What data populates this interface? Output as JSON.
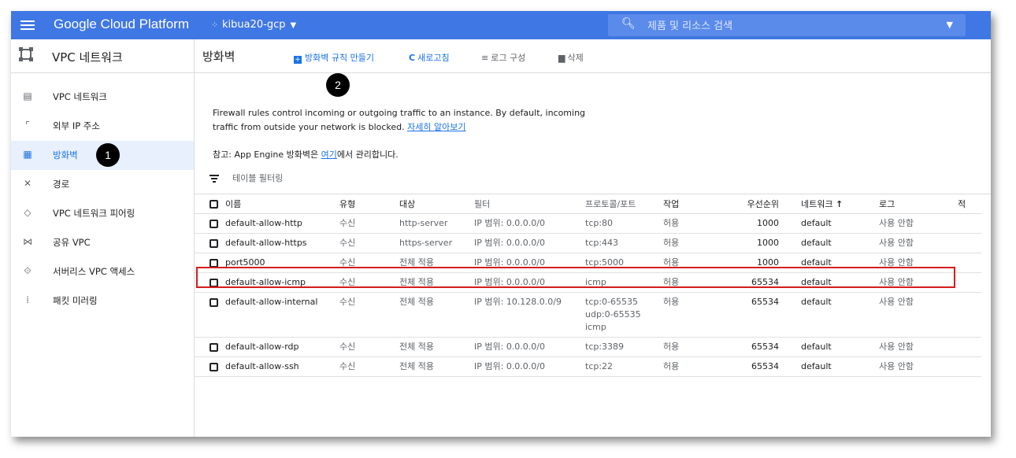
{
  "topbar": {
    "brand": "Google Cloud Platform",
    "project": "kibua20-gcp",
    "search_placeholder": "제품 및 리소스 검색"
  },
  "sidebar": {
    "title": "VPC 네트워크",
    "items": [
      {
        "label": "VPC 네트워크",
        "icon": "vpc-network-icon"
      },
      {
        "label": "외부 IP 주소",
        "icon": "external-ip-icon"
      },
      {
        "label": "방화벽",
        "icon": "firewall-icon",
        "active": true
      },
      {
        "label": "경로",
        "icon": "routes-icon"
      },
      {
        "label": "VPC 네트워크 피어링",
        "icon": "peering-icon"
      },
      {
        "label": "공유 VPC",
        "icon": "shared-vpc-icon"
      },
      {
        "label": "서버리스 VPC 액세스",
        "icon": "serverless-vpc-icon"
      },
      {
        "label": "패킷 미러링",
        "icon": "packet-mirroring-icon"
      }
    ]
  },
  "markers": {
    "one": "1",
    "two": "2"
  },
  "main": {
    "title": "방화벽",
    "actions": {
      "create": "방화벽 규칙 만들기",
      "refresh": "새로고침",
      "logs": "로그 구성",
      "delete": "삭제"
    },
    "description_1": "Firewall rules control incoming or outgoing traffic to an instance. By default, incoming traffic from outside your network is blocked.",
    "learn_more": "자세히 알아보기",
    "note_prefix": "참고: App Engine 방화벽은 ",
    "note_link": "여기",
    "note_suffix": "에서 관리합니다.",
    "filter_placeholder": "테이블 필터링"
  },
  "table": {
    "headers": {
      "name": "이름",
      "type": "유형",
      "target": "대상",
      "filter": "필터",
      "protocol": "프로토콜/포트",
      "action": "작업",
      "priority": "우선순위",
      "network": "네트워크",
      "sort_arrow": "↑",
      "logs": "로그",
      "extra": "적"
    },
    "rows": [
      {
        "name": "default-allow-http",
        "type": "수신",
        "target": "http-server",
        "filter": "IP 범위: 0.0.0.0/0",
        "protocol": [
          "tcp:80"
        ],
        "action": "허용",
        "priority": "1000",
        "network": "default",
        "logs": "사용 안함"
      },
      {
        "name": "default-allow-https",
        "type": "수신",
        "target": "https-server",
        "filter": "IP 범위: 0.0.0.0/0",
        "protocol": [
          "tcp:443"
        ],
        "action": "허용",
        "priority": "1000",
        "network": "default",
        "logs": "사용 안함"
      },
      {
        "name": "port5000",
        "type": "수신",
        "target": "전체 적용",
        "filter": "IP 범위: 0.0.0.0/0",
        "protocol": [
          "tcp:5000"
        ],
        "action": "허용",
        "priority": "1000",
        "network": "default",
        "logs": "사용 안함"
      },
      {
        "name": "default-allow-icmp",
        "type": "수신",
        "target": "전체 적용",
        "filter": "IP 범위: 0.0.0.0/0",
        "protocol": [
          "icmp"
        ],
        "action": "허용",
        "priority": "65534",
        "network": "default",
        "logs": "사용 안함"
      },
      {
        "name": "default-allow-internal",
        "type": "수신",
        "target": "전체 적용",
        "filter": "IP 범위: 10.128.0.0/9",
        "protocol": [
          "tcp:0-65535",
          "udp:0-65535",
          "icmp"
        ],
        "action": "허용",
        "priority": "65534",
        "network": "default",
        "logs": "사용 안함"
      },
      {
        "name": "default-allow-rdp",
        "type": "수신",
        "target": "전체 적용",
        "filter": "IP 범위: 0.0.0.0/0",
        "protocol": [
          "tcp:3389"
        ],
        "action": "허용",
        "priority": "65534",
        "network": "default",
        "logs": "사용 안함"
      },
      {
        "name": "default-allow-ssh",
        "type": "수신",
        "target": "전체 적용",
        "filter": "IP 범위: 0.0.0.0/0",
        "protocol": [
          "tcp:22"
        ],
        "action": "허용",
        "priority": "65534",
        "network": "default",
        "logs": "사용 안함"
      }
    ]
  },
  "colors": {
    "topbar": "#3f77e4",
    "link": "#1a73e8",
    "highlight": "#d61c1c"
  }
}
